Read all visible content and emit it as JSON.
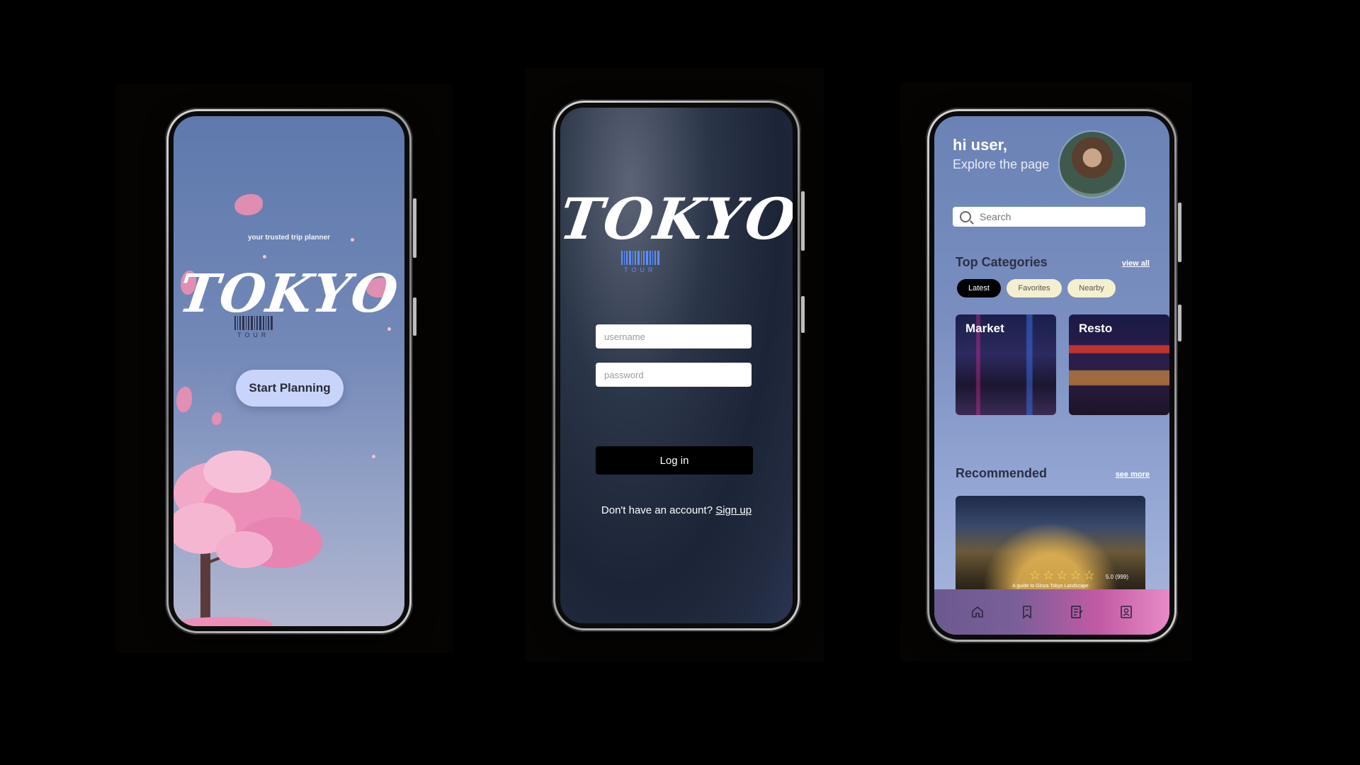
{
  "welcome": {
    "tagline": "your trusted trip planner",
    "logo_text": "TOKYO",
    "logo_subtext": "TOUR",
    "start_button": "Start Planning"
  },
  "login": {
    "logo_text": "TOKYO",
    "logo_subtext": "TOUR",
    "username_placeholder": "username",
    "password_placeholder": "password",
    "login_button": "Log in",
    "no_account_text": "Don't have an account?",
    "signup_link": "Sign up"
  },
  "home": {
    "greeting": "hi user,",
    "subgreeting": "Explore the page",
    "search_placeholder": "Search",
    "top_categories": {
      "title": "Top Categories",
      "view_all": "view all",
      "chips": [
        "Latest",
        "Favorites",
        "Nearby"
      ],
      "active_chip": "Latest",
      "cards": [
        "Market",
        "Resto"
      ]
    },
    "recommended": {
      "title": "Recommended",
      "see_more": "see more",
      "rating": "5.0 (999)",
      "stars": 5,
      "caption": "A guide to Ginza Tokyo Landscape"
    },
    "tabbar": [
      "home-icon",
      "bookmark-icon",
      "notes-icon",
      "profile-icon"
    ]
  },
  "colors": {
    "background": "#000000",
    "welcome_gradient_top": "#5f79ad",
    "start_button_bg": "#c9d4fb",
    "login_bg": "#1c2437",
    "home_bg": "#7a8fc0",
    "chip_active": "#000000",
    "chip_inactive": "#f4efcf",
    "star": "#f3e35a",
    "tabbar_accent": "#e88bc6"
  }
}
